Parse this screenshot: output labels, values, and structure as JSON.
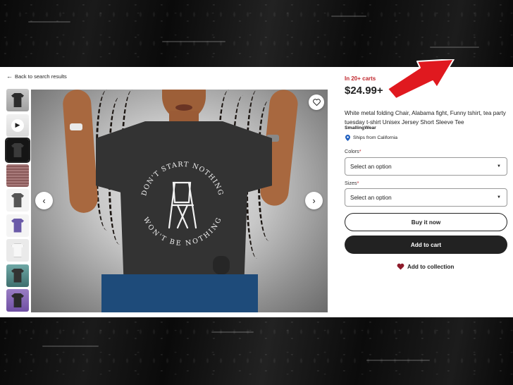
{
  "back_link": {
    "label": "Back to search results"
  },
  "product": {
    "in_carts": "In 20+ carts",
    "price": "$24.99+",
    "title": "White metal folding Chair, Alabama fight, Funny tshirt, tea party tuesday t-shirt Unisex Jersey Short Sleeve Tee",
    "shop": "SmallingWear",
    "ships_from": "Ships from California"
  },
  "options": {
    "colors_label": "Colors",
    "colors_placeholder": "Select an option",
    "sizes_label": "Sizes",
    "sizes_placeholder": "Select an option"
  },
  "actions": {
    "buy_now": "Buy it now",
    "add_to_cart": "Add to cart",
    "add_to_collection": "Add to collection"
  },
  "shirt_print": {
    "top_text": "DON'T START NOTHING",
    "bottom_text": "WON'T BE NOTHING"
  },
  "thumbnails": [
    "shirt-photo",
    "video",
    "shirt-photo-selected",
    "size-chart",
    "shirt-gray",
    "shirt-purple",
    "shirt-white",
    "shirt-teal-bg",
    "shirt-purple-bg"
  ],
  "colors": {
    "accent_red": "#c1272d",
    "button_dark": "#222222",
    "annotation_arrow": "#e0191f"
  },
  "icons": {
    "back": "arrow-left-icon",
    "favorite": "heart-icon",
    "ships": "location-pin-icon",
    "collection": "heart-filled-icon",
    "prev": "chevron-left-icon",
    "next": "chevron-right-icon",
    "play": "play-icon"
  }
}
